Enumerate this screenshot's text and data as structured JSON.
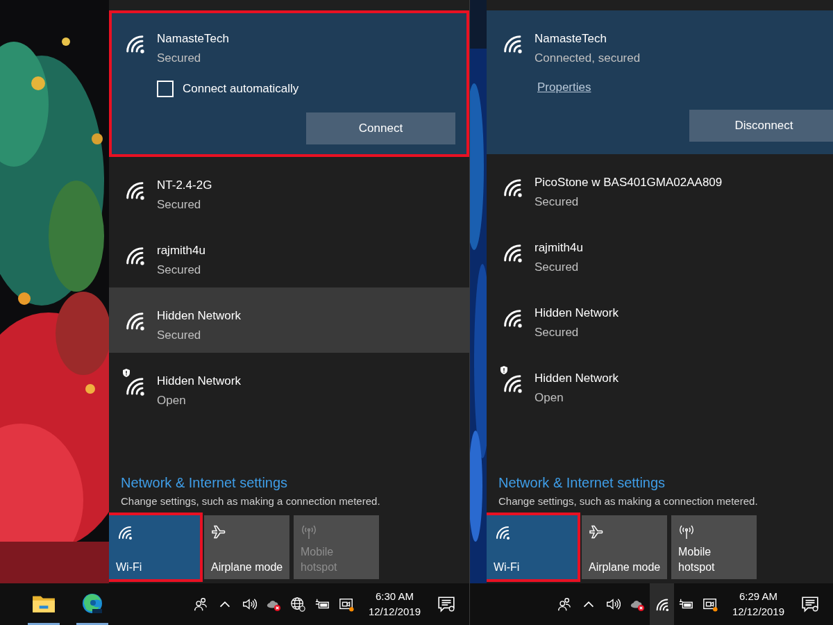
{
  "screens": [
    {
      "networks": [
        {
          "name": "NamasteTech",
          "status": "Secured",
          "expanded": true,
          "highlighted": true,
          "hovered": false,
          "open": false,
          "auto_connect": {
            "label": "Connect automatically",
            "checked": false
          },
          "action": "Connect"
        },
        {
          "name": "NT-2.4-2G",
          "status": "Secured",
          "expanded": false,
          "highlighted": false,
          "hovered": false,
          "open": false
        },
        {
          "name": "rajmith4u",
          "status": "Secured",
          "expanded": false,
          "highlighted": false,
          "hovered": false,
          "open": false
        },
        {
          "name": "Hidden Network",
          "status": "Secured",
          "expanded": false,
          "highlighted": false,
          "hovered": true,
          "open": false
        },
        {
          "name": "Hidden Network",
          "status": "Open",
          "expanded": false,
          "highlighted": false,
          "hovered": false,
          "open": true
        }
      ],
      "settings": {
        "link": "Network & Internet settings",
        "description": "Change settings, such as making a connection metered."
      },
      "tiles": [
        {
          "kind": "wifi",
          "label": [
            "Wi-Fi"
          ],
          "on": true,
          "disabled": false,
          "highlighted": true
        },
        {
          "kind": "airplane",
          "label": [
            "Airplane mode"
          ],
          "on": false,
          "disabled": false,
          "highlighted": false
        },
        {
          "kind": "hotspot",
          "label": [
            "Mobile",
            "hotspot"
          ],
          "on": false,
          "disabled": true,
          "highlighted": false
        }
      ],
      "taskbar": {
        "apps": [
          {
            "kind": "explorer",
            "running": true
          },
          {
            "kind": "edge",
            "running": true
          }
        ],
        "tray": [
          {
            "kind": "people",
            "hovered": false
          },
          {
            "kind": "chevron",
            "hovered": false
          },
          {
            "kind": "volume",
            "hovered": false
          },
          {
            "kind": "cloud-error",
            "hovered": false
          },
          {
            "kind": "globe",
            "hovered": false
          },
          {
            "kind": "battery",
            "hovered": false
          },
          {
            "kind": "meet",
            "hovered": false
          }
        ],
        "time": "6:30 AM",
        "date": "12/12/2019"
      }
    },
    {
      "networks": [
        {
          "name": "NamasteTech",
          "status": "Connected, secured",
          "expanded": true,
          "highlighted": false,
          "hovered": false,
          "open": false,
          "link": "Properties",
          "action": "Disconnect"
        },
        {
          "name": "PicoStone w BAS401GMA02AA809",
          "status": "Secured",
          "expanded": false,
          "highlighted": false,
          "hovered": false,
          "open": false
        },
        {
          "name": "rajmith4u",
          "status": "Secured",
          "expanded": false,
          "highlighted": false,
          "hovered": false,
          "open": false
        },
        {
          "name": "Hidden Network",
          "status": "Secured",
          "expanded": false,
          "highlighted": false,
          "hovered": false,
          "open": false
        },
        {
          "name": "Hidden Network",
          "status": "Open",
          "expanded": false,
          "highlighted": false,
          "hovered": false,
          "open": true
        }
      ],
      "settings": {
        "link": "Network & Internet settings",
        "description": "Change settings, such as making a connection metered."
      },
      "tiles": [
        {
          "kind": "wifi",
          "label": [
            "Wi-Fi"
          ],
          "on": true,
          "disabled": false,
          "highlighted": true
        },
        {
          "kind": "airplane",
          "label": [
            "Airplane mode"
          ],
          "on": false,
          "disabled": false,
          "highlighted": false
        },
        {
          "kind": "hotspot",
          "label": [
            "Mobile",
            "hotspot"
          ],
          "on": false,
          "disabled": false,
          "highlighted": false
        }
      ],
      "taskbar": {
        "tray": [
          {
            "kind": "people",
            "hovered": false
          },
          {
            "kind": "chevron",
            "hovered": false
          },
          {
            "kind": "volume",
            "hovered": false
          },
          {
            "kind": "cloud-error",
            "hovered": false
          },
          {
            "kind": "wifi",
            "hovered": true
          },
          {
            "kind": "battery",
            "hovered": false
          },
          {
            "kind": "meet",
            "hovered": false
          }
        ],
        "time": "6:29 AM",
        "date": "12/12/2019"
      }
    }
  ]
}
